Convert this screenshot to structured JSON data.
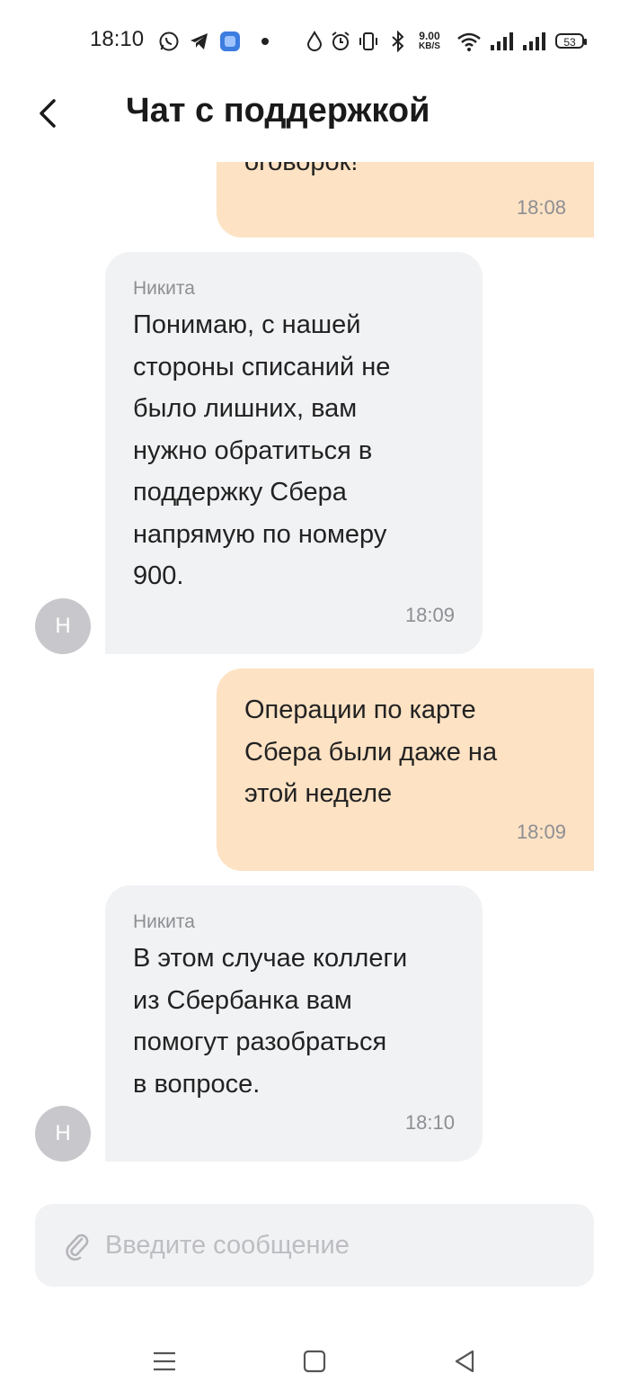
{
  "status_bar": {
    "time": "18:10",
    "net_speed_value": "9.00",
    "net_speed_unit": "KB/S",
    "battery": "53",
    "icons": [
      "whatsapp-icon",
      "telegram-icon",
      "app-icon",
      "dot-icon",
      "drop-icon",
      "alarm-icon",
      "vibrate-icon",
      "bluetooth-icon",
      "wifi-icon",
      "signal-icon",
      "signal-icon"
    ]
  },
  "header": {
    "title": "Чат с поддержкой",
    "back_icon": "chevron-left-icon"
  },
  "messages": [
    {
      "direction": "outgoing",
      "text": "оговорок!",
      "time": "18:08"
    },
    {
      "direction": "incoming",
      "sender": "Никита",
      "avatar": "Н",
      "lines": [
        "Понимаю, с нашей",
        "стороны списаний не",
        "было лишних, вам",
        "нужно обратиться в",
        "поддержку Сбера",
        "напрямую по номеру",
        "900."
      ],
      "time": "18:09"
    },
    {
      "direction": "outgoing",
      "lines": [
        "Операции по карте",
        "Сбера были даже на",
        "этой неделе"
      ],
      "time": "18:09"
    },
    {
      "direction": "incoming",
      "sender": "Никита",
      "avatar": "Н",
      "lines": [
        "В этом случае коллеги",
        "из Сбербанка вам",
        "помогут разобраться",
        "в вопросе."
      ],
      "time": "18:10"
    }
  ],
  "composer": {
    "placeholder": "Введите сообщение",
    "attach_icon": "paperclip-icon"
  },
  "nav_bar": {
    "icons": [
      "menu-icon",
      "home-square-icon",
      "back-triangle-icon"
    ]
  },
  "colors": {
    "outgoing_bubble": "#fde2c4",
    "incoming_bubble": "#f1f2f4",
    "avatar": "#c8c8cc",
    "muted_text": "#8e8e93"
  }
}
